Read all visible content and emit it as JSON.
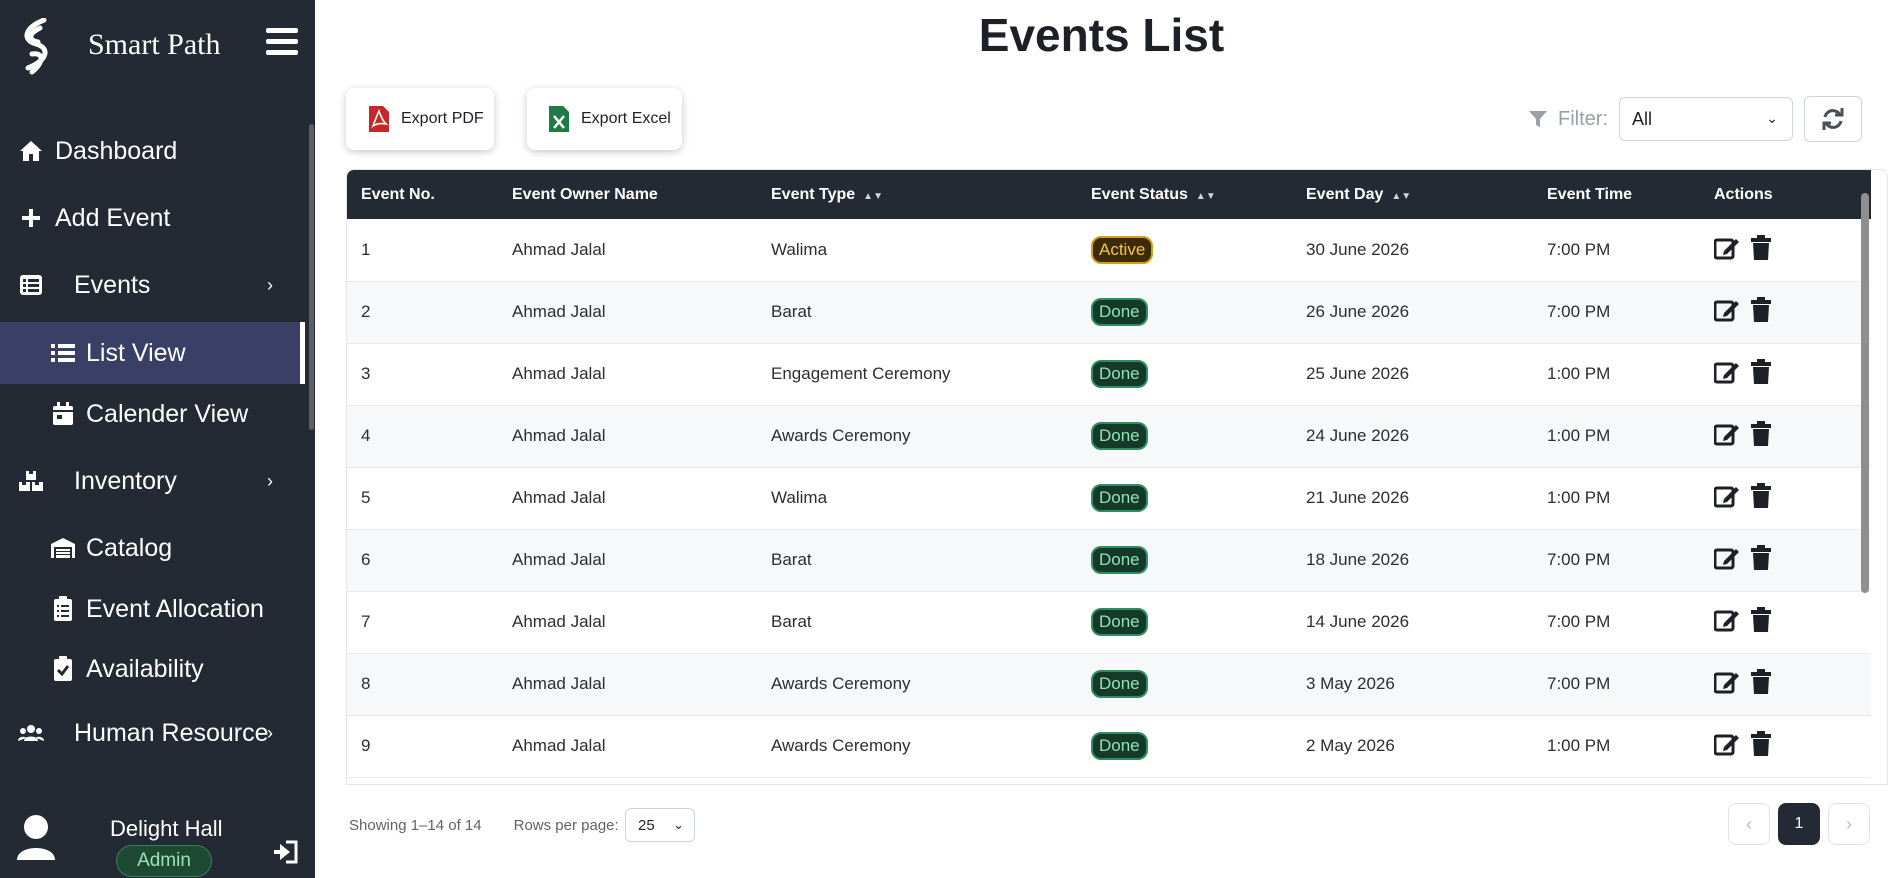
{
  "app": {
    "brand": "Smart Path"
  },
  "sidebar": {
    "items": [
      {
        "label": "Dashboard",
        "icon": "home-icon"
      },
      {
        "label": "Add Event",
        "icon": "plus-icon"
      },
      {
        "label": "Events",
        "icon": "list-box-icon",
        "has_chevron": true
      },
      {
        "label": "List View",
        "icon": "list-icon",
        "active": true
      },
      {
        "label": "Calender View",
        "icon": "calendar-icon"
      },
      {
        "label": "Inventory",
        "icon": "boxes-icon",
        "has_chevron": true
      },
      {
        "label": "Catalog",
        "icon": "warehouse-icon"
      },
      {
        "label": "Event Allocation",
        "icon": "clipboard-list-icon"
      },
      {
        "label": "Availability",
        "icon": "clipboard-check-icon"
      },
      {
        "label": "Human Resource",
        "icon": "users-icon",
        "has_chevron": true
      }
    ],
    "user": {
      "name": "Delight Hall",
      "role": "Admin"
    }
  },
  "main": {
    "title": "Events List",
    "export_pdf": "Export PDF",
    "export_excel": "Export Excel",
    "filter_label": "Filter:",
    "filter_value": "All"
  },
  "table": {
    "columns": [
      "Event No.",
      "Event Owner Name",
      "Event Type",
      "Event Status",
      "Event Day",
      "Event Time",
      "Actions"
    ],
    "rows": [
      {
        "no": "1",
        "owner": "Ahmad Jalal",
        "type": "Walima",
        "status": "Active",
        "day": "30 June 2026",
        "time": "7:00 PM"
      },
      {
        "no": "2",
        "owner": "Ahmad Jalal",
        "type": "Barat",
        "status": "Done",
        "day": "26 June 2026",
        "time": "7:00 PM"
      },
      {
        "no": "3",
        "owner": "Ahmad Jalal",
        "type": "Engagement Ceremony",
        "status": "Done",
        "day": "25 June 2026",
        "time": "1:00 PM"
      },
      {
        "no": "4",
        "owner": "Ahmad Jalal",
        "type": "Awards Ceremony",
        "status": "Done",
        "day": "24 June 2026",
        "time": "1:00 PM"
      },
      {
        "no": "5",
        "owner": "Ahmad Jalal",
        "type": "Walima",
        "status": "Done",
        "day": "21 June 2026",
        "time": "1:00 PM"
      },
      {
        "no": "6",
        "owner": "Ahmad Jalal",
        "type": "Barat",
        "status": "Done",
        "day": "18 June 2026",
        "time": "7:00 PM"
      },
      {
        "no": "7",
        "owner": "Ahmad Jalal",
        "type": "Barat",
        "status": "Done",
        "day": "14 June 2026",
        "time": "7:00 PM"
      },
      {
        "no": "8",
        "owner": "Ahmad Jalal",
        "type": "Awards Ceremony",
        "status": "Done",
        "day": "3 May 2026",
        "time": "7:00 PM"
      },
      {
        "no": "9",
        "owner": "Ahmad Jalal",
        "type": "Awards Ceremony",
        "status": "Done",
        "day": "2 May 2026",
        "time": "1:00 PM"
      }
    ]
  },
  "footer": {
    "showing": "Showing 1–14 of 14",
    "rows_per_page_label": "Rows per page:",
    "rows_per_page_value": "25",
    "current_page": "1",
    "prev": "‹",
    "next": "›"
  }
}
